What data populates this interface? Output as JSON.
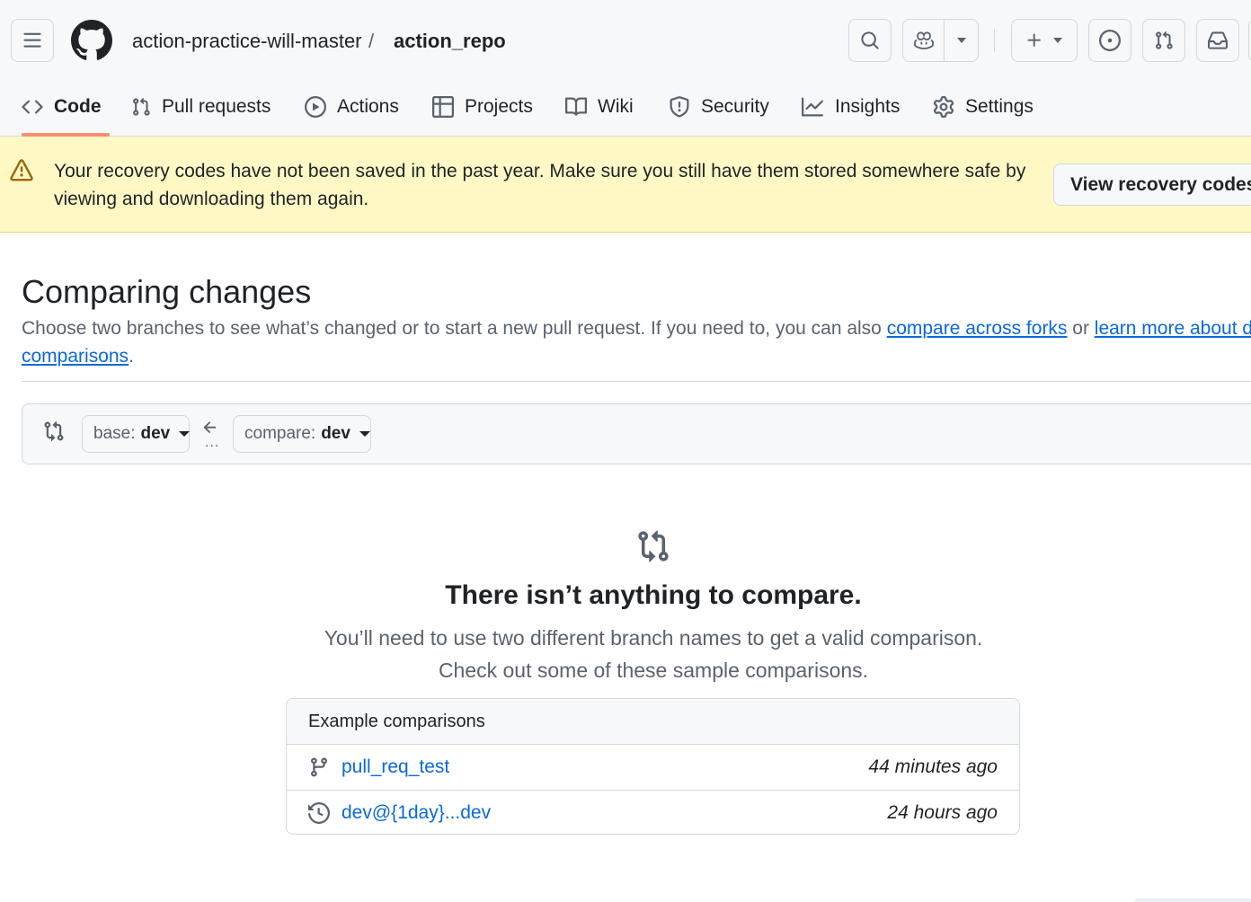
{
  "header": {
    "owner": "action-practice-will-master",
    "separator": "/",
    "repo": "action_repo"
  },
  "tabs": [
    {
      "label": "Code",
      "icon": "code-icon",
      "active": true
    },
    {
      "label": "Pull requests",
      "icon": "git-pull-request-icon"
    },
    {
      "label": "Actions",
      "icon": "play-icon"
    },
    {
      "label": "Projects",
      "icon": "table-icon"
    },
    {
      "label": "Wiki",
      "icon": "book-icon"
    },
    {
      "label": "Security",
      "icon": "shield-icon"
    },
    {
      "label": "Insights",
      "icon": "graph-icon"
    },
    {
      "label": "Settings",
      "icon": "gear-icon"
    }
  ],
  "banner": {
    "text": "Your recovery codes have not been saved in the past year. Make sure you still have them stored somewhere safe by viewing and downloading them again.",
    "button": "View recovery codes"
  },
  "page": {
    "title": "Comparing changes",
    "desc_before": "Choose two branches to see what’s changed or to start a new pull request. If you need to, you can also ",
    "link_forks": "compare across forks",
    "desc_or": " or ",
    "link_learn": "learn more about diff comparisons",
    "desc_end": "."
  },
  "compare": {
    "base_prefix": "base:",
    "base_branch": "dev",
    "compare_prefix": "compare:",
    "compare_branch": "dev",
    "dots": "..."
  },
  "blank_state": {
    "title": "There isn’t anything to compare.",
    "line1": "You’ll need to use two different branch names to get a valid comparison.",
    "line2": "Check out some of these sample comparisons."
  },
  "examples": {
    "heading": "Example comparisons",
    "rows": [
      {
        "label": "pull_req_test",
        "time": "44 minutes ago",
        "icon": "git-branch-icon"
      },
      {
        "label": "dev@{1day}...dev",
        "time": "24 hours ago",
        "icon": "history-icon"
      }
    ]
  },
  "colors": {
    "accent_link": "#0969da",
    "active_tab_underline": "#fd8c73",
    "banner_bg": "#fff8c5",
    "header_bg": "#f6f8fa"
  }
}
